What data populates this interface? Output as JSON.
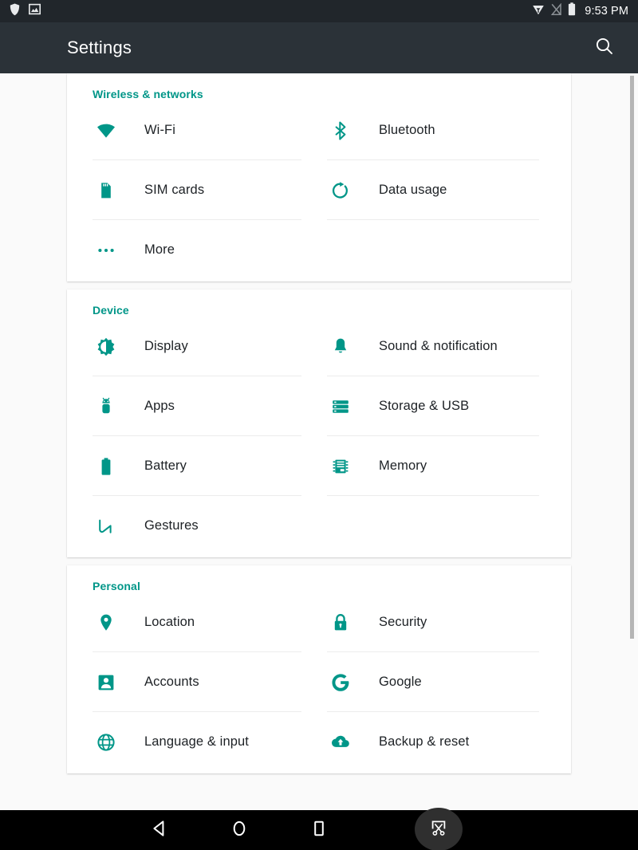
{
  "statusbar": {
    "left_icons": [
      {
        "name": "shield-icon",
        "glyph": "shield"
      },
      {
        "name": "screenshot-image-icon",
        "glyph": "image"
      }
    ],
    "right_icons": [
      {
        "name": "vpn-key-icon",
        "glyph": "vpn"
      },
      {
        "name": "no-signal-icon",
        "glyph": "signal-off"
      },
      {
        "name": "battery-full-icon",
        "glyph": "battery"
      }
    ],
    "clock": "9:53 PM"
  },
  "appbar": {
    "title": "Settings",
    "search_icon": "search-icon"
  },
  "theme": {
    "accent": "#009688",
    "appbar_bg": "#2b3238",
    "statusbar_bg": "#21262b",
    "page_bg": "#fafafa",
    "card_bg": "#ffffff",
    "text": "#1d2125",
    "divider": "#ececec",
    "navbar_bg": "#000000"
  },
  "sections": [
    {
      "header": "Wireless & networks",
      "items": [
        {
          "label": "Wi-Fi",
          "icon": "wifi-icon"
        },
        {
          "label": "Bluetooth",
          "icon": "bluetooth-icon"
        },
        {
          "label": "SIM cards",
          "icon": "sim-card-icon"
        },
        {
          "label": "Data usage",
          "icon": "data-usage-icon"
        },
        {
          "label": "More",
          "icon": "more-dots-icon"
        }
      ]
    },
    {
      "header": "Device",
      "items": [
        {
          "label": "Display",
          "icon": "brightness-icon"
        },
        {
          "label": "Sound & notification",
          "icon": "bell-icon"
        },
        {
          "label": "Apps",
          "icon": "android-icon"
        },
        {
          "label": "Storage & USB",
          "icon": "storage-icon"
        },
        {
          "label": "Battery",
          "icon": "battery-icon"
        },
        {
          "label": "Memory",
          "icon": "memory-chip-icon"
        },
        {
          "label": "Gestures",
          "icon": "gestures-icon"
        }
      ]
    },
    {
      "header": "Personal",
      "items": [
        {
          "label": "Location",
          "icon": "location-pin-icon"
        },
        {
          "label": "Security",
          "icon": "lock-icon"
        },
        {
          "label": "Accounts",
          "icon": "account-box-icon"
        },
        {
          "label": "Google",
          "icon": "google-g-icon"
        },
        {
          "label": "Language & input",
          "icon": "globe-icon"
        },
        {
          "label": "Backup & reset",
          "icon": "cloud-upload-icon"
        }
      ]
    }
  ],
  "navbar": {
    "buttons": [
      {
        "name": "back-button",
        "icon": "back-triangle-icon"
      },
      {
        "name": "home-button",
        "icon": "home-circle-icon"
      },
      {
        "name": "recents-button",
        "icon": "recents-square-icon"
      },
      {
        "name": "screenshot-button",
        "icon": "scissors-screenshot-icon"
      }
    ]
  }
}
